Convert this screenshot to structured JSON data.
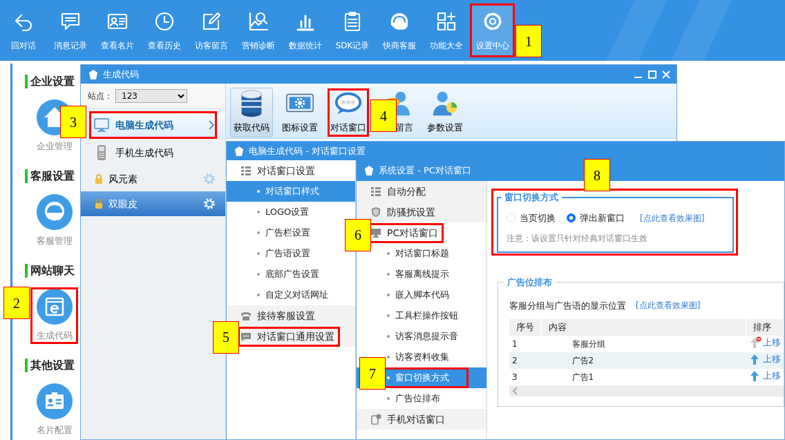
{
  "toolbar": [
    {
      "label": "回对话",
      "selected": false,
      "highlighted": false
    },
    {
      "label": "消息记录",
      "selected": false,
      "highlighted": false
    },
    {
      "label": "查看名片",
      "selected": false,
      "highlighted": false
    },
    {
      "label": "查看历史",
      "selected": false,
      "highlighted": false
    },
    {
      "label": "访客留言",
      "selected": false,
      "highlighted": false
    },
    {
      "label": "营销诊断",
      "selected": false,
      "highlighted": false
    },
    {
      "label": "数据统计",
      "selected": false,
      "highlighted": false
    },
    {
      "label": "SDK记录",
      "selected": false,
      "highlighted": false
    },
    {
      "label": "快商客服",
      "selected": false,
      "highlighted": false
    },
    {
      "label": "功能大全",
      "selected": false,
      "highlighted": false
    },
    {
      "label": "设置中心",
      "selected": true,
      "highlighted": true,
      "callout": "1"
    }
  ],
  "sidebar": [
    {
      "title": "企业设置",
      "items": [
        {
          "label": "企业管理",
          "highlighted": false
        }
      ]
    },
    {
      "title": "客服设置",
      "items": [
        {
          "label": "客服管理",
          "highlighted": false
        }
      ]
    },
    {
      "title": "网站聊天",
      "items": [
        {
          "label": "生成代码",
          "highlighted": true,
          "callout": "2"
        }
      ]
    },
    {
      "title": "其他设置",
      "items": [
        {
          "label": "名片配置",
          "highlighted": false
        }
      ]
    }
  ],
  "code_window": {
    "title": "生成代码",
    "site": {
      "label": "站点：",
      "value": "123"
    },
    "code_types": [
      {
        "label": "电脑生成代码",
        "selected": true,
        "highlighted": true,
        "callout": "3"
      },
      {
        "label": "手机生成代码",
        "selected": false,
        "highlighted": false
      }
    ],
    "skins": [
      {
        "label": "风元素",
        "selected": false
      },
      {
        "label": "双眼皮",
        "selected": true
      }
    ],
    "tools": [
      {
        "label": "获取代码",
        "selected": true,
        "highlighted": false
      },
      {
        "label": "图标设置",
        "selected": false,
        "highlighted": false
      },
      {
        "label": "对话窗口",
        "selected": false,
        "highlighted": true,
        "callout": "4"
      },
      {
        "label": "留言",
        "selected": false,
        "highlighted": false
      },
      {
        "label": "参数设置",
        "selected": false,
        "highlighted": false
      }
    ]
  },
  "dialog_window": {
    "title": "电脑生成代码 - 对话窗口设置",
    "menu": [
      {
        "label": "对话窗口设置",
        "expanded": true,
        "highlighted": false,
        "children": [
          {
            "label": "对话窗口样式",
            "selected": true
          },
          {
            "label": "LOGO设置",
            "selected": false
          },
          {
            "label": "广告栏设置",
            "selected": false
          },
          {
            "label": "广告语设置",
            "selected": false
          },
          {
            "label": "底部广告设置",
            "selected": false
          },
          {
            "label": "自定义对话网址",
            "selected": false
          }
        ]
      },
      {
        "label": "接待客服设置",
        "expanded": false,
        "highlighted": false
      },
      {
        "label": "对话窗口通用设置",
        "expanded": false,
        "highlighted": true,
        "callout": "5"
      }
    ]
  },
  "pc_window": {
    "title": "系统设置 - PC对话窗口",
    "menu": [
      {
        "label": "自动分配",
        "expanded": false,
        "highlighted": false
      },
      {
        "label": "防骚扰设置",
        "expanded": false,
        "highlighted": false
      },
      {
        "label": "PC对话窗口",
        "expanded": true,
        "highlighted": true,
        "callout": "6",
        "children": [
          {
            "label": "对话窗口标题",
            "selected": false,
            "highlighted": false
          },
          {
            "label": "客服离线提示",
            "selected": false,
            "highlighted": false
          },
          {
            "label": "嵌入脚本代码",
            "selected": false,
            "highlighted": false
          },
          {
            "label": "工具栏操作按钮",
            "selected": false,
            "highlighted": false
          },
          {
            "label": "访客消息提示音",
            "selected": false,
            "highlighted": false
          },
          {
            "label": "访客资料收集",
            "selected": false,
            "highlighted": false
          },
          {
            "label": "窗口切换方式",
            "selected": true,
            "highlighted": true,
            "callout": "7"
          },
          {
            "label": "广告位排布",
            "selected": false,
            "highlighted": false
          }
        ]
      },
      {
        "label": "手机对话窗口",
        "expanded": false,
        "highlighted": false
      }
    ],
    "switch_mode": {
      "legend": "窗口切换方式",
      "highlighted": true,
      "callout": "8",
      "options": [
        {
          "label": "当页切换",
          "selected": false
        },
        {
          "label": "弹出新窗口",
          "selected": true
        }
      ],
      "preview_link": "[点此查看效果图]",
      "note": "注意：该设置只针对经典对话窗口生效"
    },
    "ad_layout": {
      "legend": "广告位排布",
      "description": "客服分组与广告语的显示位置",
      "preview_link": "[点此查看效果图]",
      "columns": [
        "序号",
        "内容",
        "排序"
      ],
      "rows": [
        {
          "cells": [
            "1",
            "客服分组"
          ],
          "action": "上移",
          "disabled": true,
          "selected": false
        },
        {
          "cells": [
            "2",
            "广告2"
          ],
          "action": "上移",
          "disabled": false,
          "selected": true
        },
        {
          "cells": [
            "3",
            "广告1"
          ],
          "action": "上移",
          "disabled": false,
          "selected": false
        }
      ]
    }
  }
}
